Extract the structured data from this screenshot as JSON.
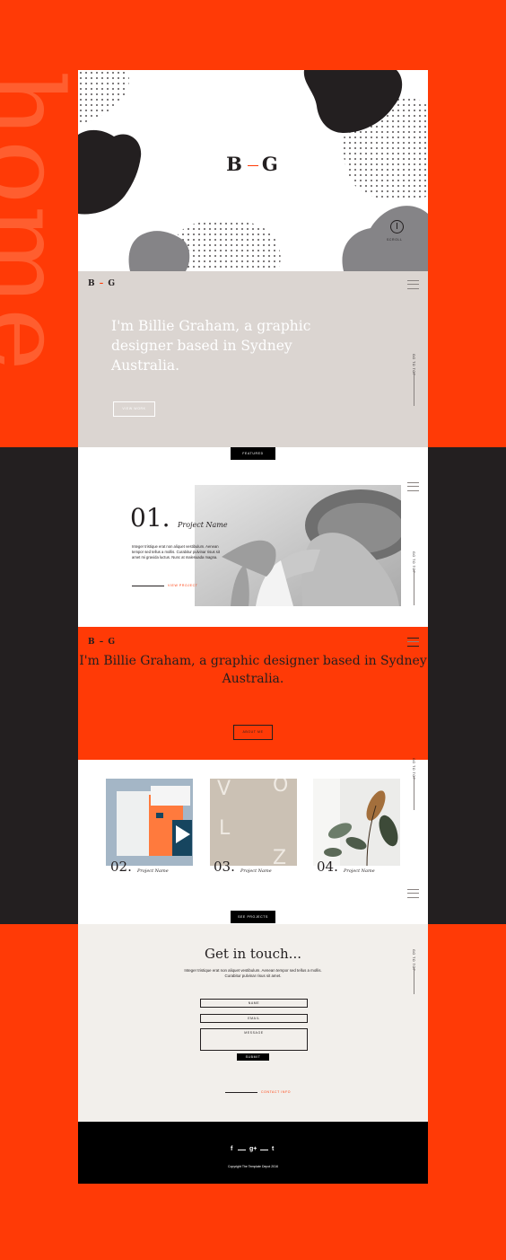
{
  "side_word": "home",
  "hero": {
    "logo_left": "B",
    "logo_right": "G",
    "scroll_label": "SCROLL"
  },
  "nav": {
    "logo_left": "B",
    "logo_right": "G",
    "go_to_top": "GO TO TOP"
  },
  "intro": {
    "headline": "I'm Billie Graham, a graphic designer based in Sydney Australia.",
    "button": "VIEW WORK"
  },
  "featured": {
    "tag": "FEATURED",
    "number": "01.",
    "project_name": "Project Name",
    "body": "Integer tristique erat non aliquet vestibulum. Aenean tempor sed tellus a mollis. Curabitur pulvinar risus sit amet mi gravida luctus. Nunc at malesuada magna.",
    "link": "VIEW PROJECT"
  },
  "about": {
    "headline": "I'm Billie Graham, a graphic designer based in Sydney Australia.",
    "button": "ABOUT ME"
  },
  "projects": [
    {
      "number": "02.",
      "name": "Project Name"
    },
    {
      "number": "03.",
      "name": "Project Name"
    },
    {
      "number": "04.",
      "name": "Project Name"
    }
  ],
  "see_projects": "SEE PROJECTS",
  "contact": {
    "title": "Get in touch...",
    "body": "Integer tristique erat non aliquet vestibulum. Aenean tempor sed tellus a mollis. Curabitur pulvinar risus sit amet.",
    "name_placeholder": "NAME",
    "email_placeholder": "EMAIL",
    "message_placeholder": "MESSAGE",
    "submit": "SUBMIT",
    "link": "CONTACT INFO"
  },
  "footer": {
    "social": [
      "f",
      "g+",
      "t"
    ],
    "copyright": "Copyright The Template Depot 2016"
  },
  "colors": {
    "accent": "#ff3a06",
    "dark": "#231f20",
    "taupe": "#dbd5d1",
    "paper": "#f2efeb",
    "gray_blob": "#858487"
  }
}
